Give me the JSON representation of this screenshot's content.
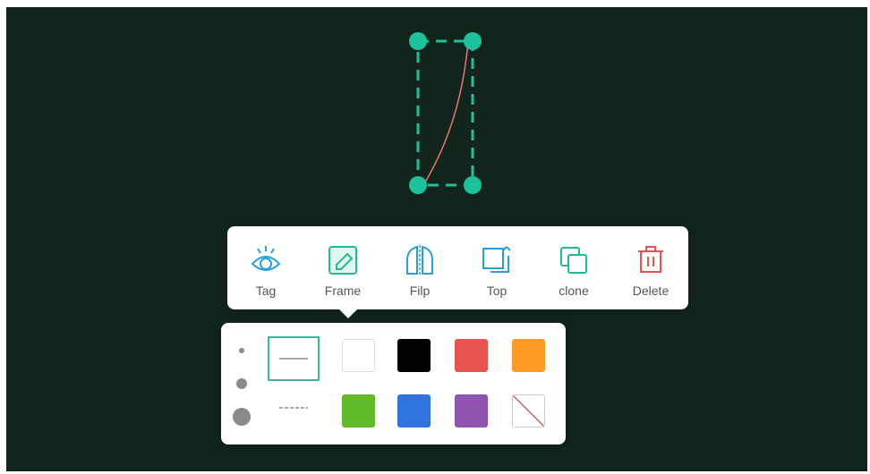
{
  "canvas": {
    "background": "#11251c"
  },
  "selection": {
    "handle_color": "#1dc29c",
    "border_color": "#1dc29c",
    "stroke_color": "#e8766a"
  },
  "toolbar": {
    "items": [
      {
        "label": "Tag",
        "icon": "eye-icon",
        "color": "#2a9fd8"
      },
      {
        "label": "Frame",
        "icon": "frame-pencil-icon",
        "color": "#1dbb93"
      },
      {
        "label": "Filp",
        "icon": "flip-icon",
        "color": "#2a9fd8"
      },
      {
        "label": "Top",
        "icon": "bring-to-top-icon",
        "color": "#2a9fd8"
      },
      {
        "label": "clone",
        "icon": "clone-icon",
        "color": "#1dbb93"
      },
      {
        "label": "Delete",
        "icon": "trash-icon",
        "color": "#e8524f"
      }
    ]
  },
  "style_panel": {
    "sizes": [
      "small",
      "medium",
      "large"
    ],
    "line_styles": [
      "solid",
      "dashed"
    ],
    "selected_line_style": "solid",
    "colors": [
      {
        "name": "white",
        "value": "#ffffff"
      },
      {
        "name": "black",
        "value": "#000000"
      },
      {
        "name": "red",
        "value": "#e8524f"
      },
      {
        "name": "orange",
        "value": "#fd9c25"
      },
      {
        "name": "green",
        "value": "#61ba28"
      },
      {
        "name": "blue",
        "value": "#3174df"
      },
      {
        "name": "purple",
        "value": "#8f54b2"
      },
      {
        "name": "none",
        "value": "transparent"
      }
    ]
  }
}
